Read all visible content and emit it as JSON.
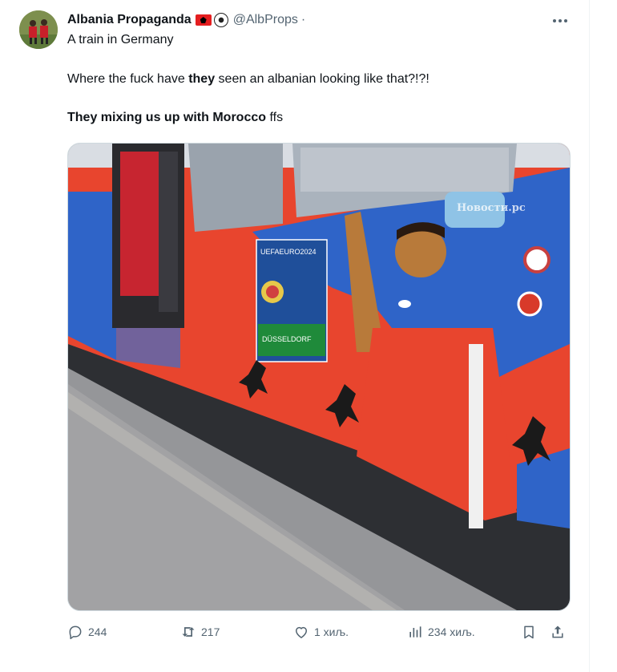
{
  "user": {
    "name": "Albania Propaganda",
    "handle": "@AlbProps",
    "separator": "·",
    "location_line": "A train in Germany"
  },
  "tweet": {
    "line1_pre": "Where the fuck have ",
    "line1_bold": "they",
    "line1_post": " seen an albanian looking like that?!?!",
    "line2_bold": "They mixing us up with Morocco",
    "line2_post": " ffs"
  },
  "media": {
    "watermark": "Новости.рс",
    "poster_title": "UEFAEURO2024",
    "poster_city": "DÜSSELDORF"
  },
  "actions": {
    "replies": "244",
    "reposts": "217",
    "likes": "1 хиљ.",
    "views": "234 хиљ."
  },
  "colors": {
    "text": "#0f1419",
    "secondary": "#536471",
    "border": "#cfd9de",
    "train_red": "#e8452e",
    "train_blue": "#2f64c8"
  },
  "icons": [
    "reply-icon",
    "repost-icon",
    "like-icon",
    "views-icon",
    "bookmark-icon",
    "share-icon",
    "more-icon"
  ]
}
